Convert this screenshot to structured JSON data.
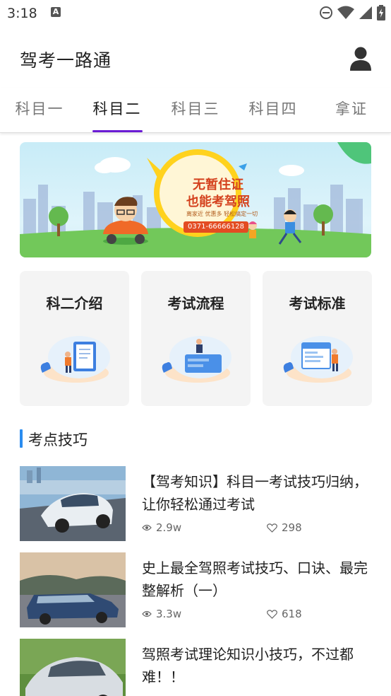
{
  "status_bar": {
    "time": "3:18",
    "indicator": "A",
    "icons": [
      "dnd-icon",
      "wifi-icon",
      "signal-icon",
      "battery-icon"
    ]
  },
  "header": {
    "title": "驾考一路通",
    "user_icon": "user-icon"
  },
  "tabs": [
    {
      "label": "科目一",
      "active": false
    },
    {
      "label": "科目二",
      "active": true
    },
    {
      "label": "科目三",
      "active": false
    },
    {
      "label": "科目四",
      "active": false
    },
    {
      "label": "拿证",
      "active": false
    }
  ],
  "banner": {
    "title_line1": "无暂住证",
    "title_line2": "也能考驾照",
    "slogan": "离家近  优惠多  轻松搞定一切",
    "phone": "0371-66666128"
  },
  "cards": [
    {
      "title": "科二介绍",
      "icon": "document-board-icon"
    },
    {
      "title": "考试流程",
      "icon": "card-reader-icon"
    },
    {
      "title": "考试标准",
      "icon": "checklist-icon"
    }
  ],
  "section": {
    "title": "考点技巧"
  },
  "articles": [
    {
      "title": "【驾考知识】科目一考试技巧归纳，让你轻松通过考试",
      "views": "2.9w",
      "likes": "298"
    },
    {
      "title": "史上最全驾照考试技巧、口诀、最完整解析（一）",
      "views": "3.3w",
      "likes": "618"
    },
    {
      "title": "驾照考试理论知识小技巧，不过都难！！",
      "views": "",
      "likes": ""
    }
  ],
  "colors": {
    "accent_tab": "#6a1bd4",
    "section_bar": "#2a8cf0",
    "phone_badge": "#e34c22"
  }
}
